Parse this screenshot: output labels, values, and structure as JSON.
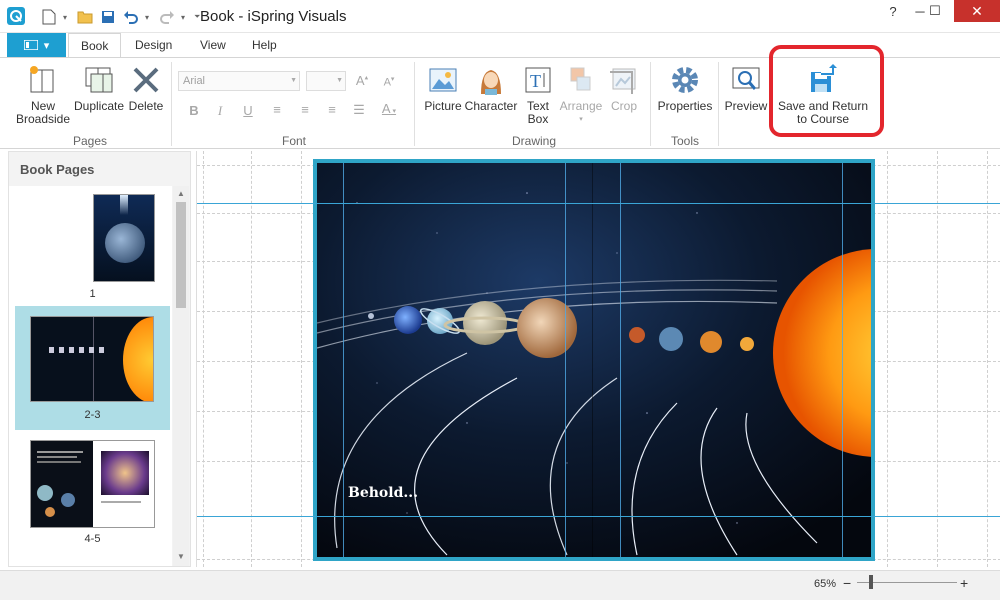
{
  "window": {
    "title": "Book - iSpring Visuals",
    "minimize": "─",
    "maximize": "☐",
    "close": "✕"
  },
  "tabs": {
    "file_icon": "menu-icon",
    "items": [
      {
        "label": "Book",
        "active": true
      },
      {
        "label": "Design",
        "active": false
      },
      {
        "label": "View",
        "active": false
      },
      {
        "label": "Help",
        "active": false
      }
    ]
  },
  "ribbon": {
    "pages": {
      "label": "Pages",
      "new_broadside": "New\nBroadside",
      "duplicate": "Duplicate",
      "delete": "Delete"
    },
    "font": {
      "label": "Font",
      "font_name": "Arial",
      "font_size": "",
      "bold": "B",
      "italic": "I",
      "underline": "U",
      "color_letter": "A"
    },
    "drawing": {
      "label": "Drawing",
      "picture": "Picture",
      "character": "Character",
      "text_box": "Text\nBox",
      "arrange": "Arrange",
      "crop": "Crop"
    },
    "tools": {
      "label": "Tools",
      "properties": "Properties"
    },
    "preview": "Preview",
    "save_return": "Save and Return\nto Course"
  },
  "left_panel": {
    "title": "Book Pages",
    "pages": [
      {
        "number": "1",
        "selected": false
      },
      {
        "number": "2-3",
        "selected": true
      },
      {
        "number": "4-5",
        "selected": false
      }
    ]
  },
  "canvas": {
    "slide_text": "Behold..."
  },
  "status": {
    "zoom": "65%",
    "zoom_level": 0.14
  },
  "colors": {
    "accent": "#1e9fd1",
    "highlight": "#e3262d",
    "selection": "#aedde6"
  }
}
